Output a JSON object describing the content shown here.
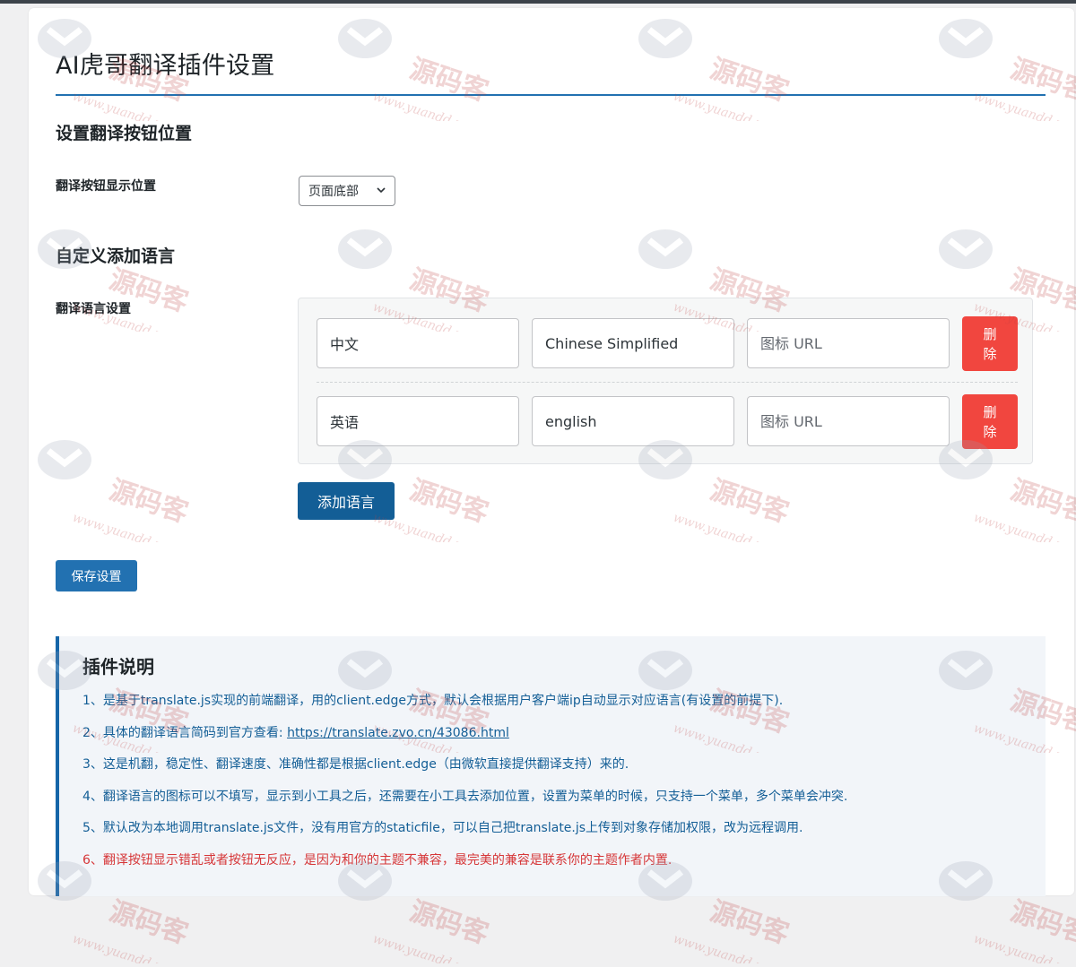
{
  "page_title": "AI虎哥翻译插件设置",
  "button_position_section": {
    "heading": "设置翻译按钮位置",
    "label": "翻译按钮显示位置",
    "selected": "页面底部"
  },
  "language_section": {
    "heading": "自定义添加语言",
    "label": "翻译语言设置",
    "icon_url_placeholder": "图标 URL",
    "delete_label": "删\n除",
    "rows": [
      {
        "name": "中文",
        "code": "Chinese Simplified",
        "icon_url": ""
      },
      {
        "name": "英语",
        "code": "english",
        "icon_url": ""
      }
    ],
    "add_button": "添加语言"
  },
  "save_button": "保存设置",
  "info": {
    "title": "插件说明",
    "notes": [
      "1、是基于translate.js实现的前端翻译，用的client.edge方式，默认会根据用户客户端ip自动显示对应语言(有设置的前提下).",
      "2、具体的翻译语言简码到官方查看: ",
      "3、这是机翻，稳定性、翻译速度、准确性都是根据client.edge（由微软直接提供翻译支持）来的.",
      "4、翻译语言的图标可以不填写，显示到小工具之后，还需要在小工具去添加位置，设置为菜单的时候，只支持一个菜单，多个菜单会冲突.",
      "5、默认改为本地调用translate.js文件，没有用官方的staticfile，可以自己把translate.js上传到对象存储加权限，改为远程调用.",
      "6、翻译按钮显示错乱或者按钮无反应，是因为和你的主题不兼容，最完美的兼容是联系你的主题作者内置."
    ],
    "link": "https://translate.zvo.cn/43086.html"
  },
  "watermark": {
    "brand": "源码客",
    "url": "www.yuandd.net"
  },
  "colors": {
    "primary": "#2271b1",
    "delete": "#f1463f",
    "info_border": "#1565a8",
    "warning_text": "#d63638"
  }
}
